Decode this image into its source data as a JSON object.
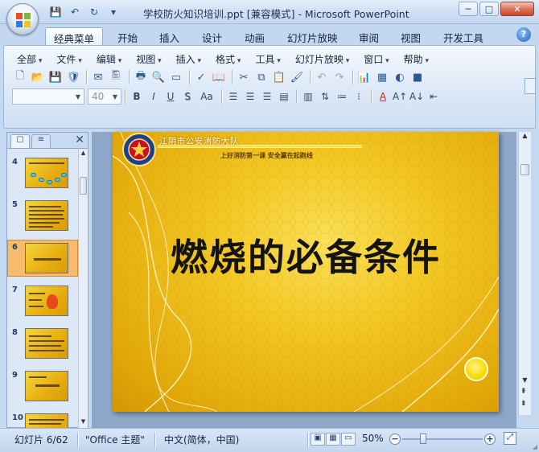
{
  "window": {
    "title": "学校防火知识培训.ppt [兼容模式] - Microsoft PowerPoint",
    "controls": {
      "minimize": "─",
      "maximize": "□",
      "close": "✕"
    }
  },
  "quick_access": {
    "save": "💾",
    "undo": "↶",
    "redo": "↻",
    "more": "▾"
  },
  "ribbon_tabs": [
    {
      "label": "经典菜单",
      "active": true
    },
    {
      "label": "开始"
    },
    {
      "label": "插入"
    },
    {
      "label": "设计"
    },
    {
      "label": "动画"
    },
    {
      "label": "幻灯片放映"
    },
    {
      "label": "审阅"
    },
    {
      "label": "视图"
    },
    {
      "label": "开发工具"
    }
  ],
  "help": "?",
  "classic_menu": [
    "全部",
    "文件",
    "编辑",
    "视图",
    "插入",
    "格式",
    "工具",
    "幻灯片放映",
    "窗口",
    "帮助"
  ],
  "font": {
    "name_placeholder": "",
    "size": "40"
  },
  "format_buttons": {
    "bold": "B",
    "italic": "I",
    "underline": "U",
    "shadow": "S",
    "case": "Aa"
  },
  "left_panel": {
    "tab_slides_icon": "▢",
    "tab_outline_icon": "≡",
    "close": "✕",
    "thumbnails": [
      {
        "number": "4"
      },
      {
        "number": "5"
      },
      {
        "number": "6",
        "selected": true
      },
      {
        "number": "7"
      },
      {
        "number": "8"
      },
      {
        "number": "9"
      },
      {
        "number": "10"
      }
    ]
  },
  "slide": {
    "organization": "江阴市公安消防大队",
    "slogan": "上好消防第一课   安全赢在起跑线",
    "title": "燃烧的必备条件"
  },
  "vscroll": {
    "up": "▲",
    "down": "▼",
    "prev_page": "⇞",
    "next_page": "⇟"
  },
  "status": {
    "slide_counter": "幻灯片 6/62",
    "theme": "\"Office 主题\"",
    "language": "中文(简体，中国)",
    "zoom": "50%",
    "zoom_minus": "−",
    "zoom_plus": "+",
    "zoom_level_fraction": 0.5
  },
  "colors": {
    "slide_yellow": "#f3c825",
    "accent_blue": "#c3d7f0",
    "selection_orange": "#f6bb6c"
  }
}
